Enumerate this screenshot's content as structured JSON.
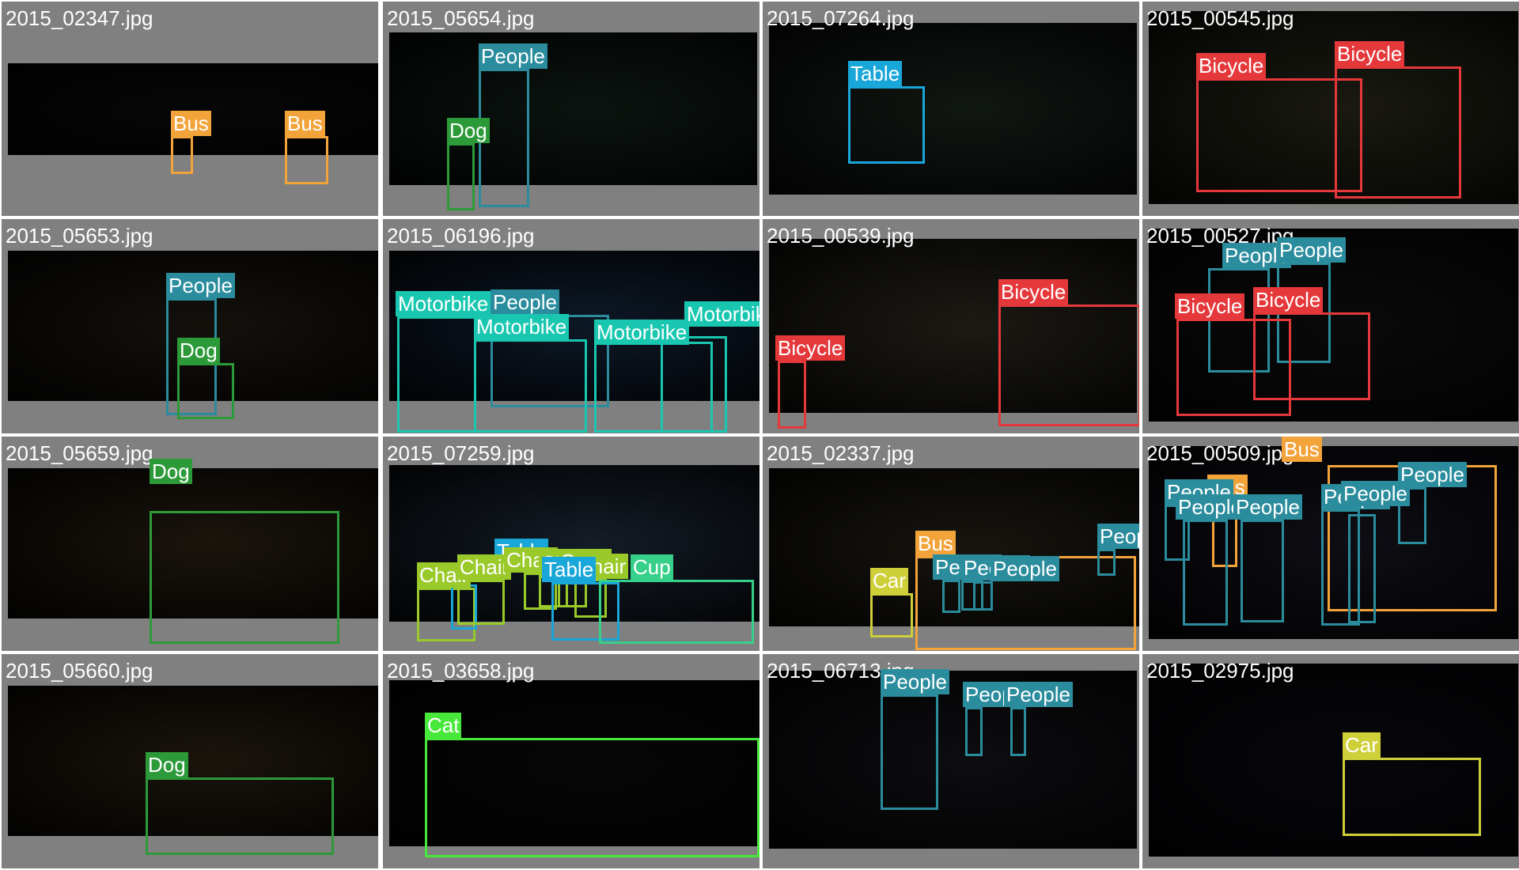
{
  "grid": {
    "colors": {
      "Bus": "#f2a33a",
      "People": "#2a8c9c",
      "Dog": "#2d9a3a",
      "Table": "#19a6d8",
      "Bicycle": "#e5383b",
      "Motorbike": "#19c7b0",
      "Chair": "#9ac92a",
      "Car": "#cfcf3a",
      "Cup": "#36d08a",
      "Cat": "#48e83a"
    },
    "cells": [
      {
        "filename": "2015_02347.jpg",
        "photo_tone": "#070707",
        "detections": [
          {
            "label": "Bus"
          },
          {
            "label": "Bus"
          }
        ]
      },
      {
        "filename": "2015_05654.jpg",
        "photo_tone": "#0c1410",
        "detections": [
          {
            "label": "People"
          },
          {
            "label": "Dog"
          }
        ]
      },
      {
        "filename": "2015_07264.jpg",
        "photo_tone": "#111713",
        "detections": [
          {
            "label": "Table"
          }
        ]
      },
      {
        "filename": "2015_00545.jpg",
        "photo_tone": "#1a1a12",
        "detections": [
          {
            "label": "Bicycle"
          },
          {
            "label": "Bicycle"
          }
        ]
      },
      {
        "filename": "2015_05653.jpg",
        "photo_tone": "#14110d",
        "detections": [
          {
            "label": "People"
          },
          {
            "label": "Dog"
          }
        ]
      },
      {
        "filename": "2015_06196.jpg",
        "photo_tone": "#0d1826",
        "detections": [
          {
            "label": "Motorbike"
          },
          {
            "label": "People"
          },
          {
            "label": "Motorbike"
          },
          {
            "label": "Motorbike"
          },
          {
            "label": "Motorbike"
          }
        ]
      },
      {
        "filename": "2015_00539.jpg",
        "photo_tone": "#1c1a14",
        "detections": [
          {
            "label": "Bicycle"
          },
          {
            "label": "Bicycle"
          }
        ]
      },
      {
        "filename": "2015_00527.jpg",
        "photo_tone": "#0a0a0a",
        "detections": [
          {
            "label": "People"
          },
          {
            "label": "People"
          },
          {
            "label": "Bicycle"
          },
          {
            "label": "Bicycle"
          }
        ]
      },
      {
        "filename": "2015_05659.jpg",
        "photo_tone": "#1a140c",
        "detections": [
          {
            "label": "Dog"
          }
        ]
      },
      {
        "filename": "2015_07259.jpg",
        "photo_tone": "#141c26",
        "detections": [
          {
            "label": "Chair"
          },
          {
            "label": "Table"
          },
          {
            "label": "Chair"
          },
          {
            "label": "Chair"
          },
          {
            "label": "Chair"
          },
          {
            "label": "Chair"
          },
          {
            "label": "Chair"
          },
          {
            "label": "Table"
          },
          {
            "label": "Cup"
          }
        ]
      },
      {
        "filename": "2015_02337.jpg",
        "photo_tone": "#17150f",
        "detections": [
          {
            "label": "Bus"
          },
          {
            "label": "People"
          },
          {
            "label": "Car"
          },
          {
            "label": "People"
          },
          {
            "label": "People"
          },
          {
            "label": "People"
          }
        ]
      },
      {
        "filename": "2015_00509.jpg",
        "photo_tone": "#0e0e14",
        "detections": [
          {
            "label": "Bus"
          },
          {
            "label": "Bus"
          },
          {
            "label": "People"
          },
          {
            "label": "People"
          },
          {
            "label": "People"
          },
          {
            "label": "People"
          },
          {
            "label": "People"
          },
          {
            "label": "People"
          }
        ]
      },
      {
        "filename": "2015_05660.jpg",
        "photo_tone": "#1a140c",
        "detections": [
          {
            "label": "Dog"
          }
        ]
      },
      {
        "filename": "2015_03658.jpg",
        "photo_tone": "#060606",
        "detections": [
          {
            "label": "Cat"
          }
        ]
      },
      {
        "filename": "2015_06713.jpg",
        "photo_tone": "#0d0d10",
        "detections": [
          {
            "label": "People"
          },
          {
            "label": "People"
          },
          {
            "label": "People"
          }
        ]
      },
      {
        "filename": "2015_02975.jpg",
        "photo_tone": "#07070b",
        "detections": [
          {
            "label": "Car"
          }
        ]
      }
    ]
  }
}
